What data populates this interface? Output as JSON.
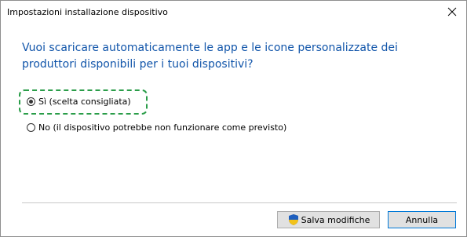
{
  "window": {
    "title": "Impostazioni installazione dispositivo"
  },
  "question": "Vuoi scaricare automaticamente le app e le icone personalizzate dei produttori disponibili per i tuoi dispositivi?",
  "options": [
    {
      "label": "Sì (scelta consigliata)",
      "selected": true
    },
    {
      "label": "No (il dispositivo potrebbe non funzionare come previsto)",
      "selected": false
    }
  ],
  "buttons": {
    "save_label": "Salva modifiche",
    "cancel_label": "Annulla"
  },
  "icons": {
    "save": "shield-icon",
    "close": "close-icon"
  },
  "colors": {
    "question_text": "#1155aa",
    "highlight": "#2a9d49",
    "default_button_border": "#0078d7"
  }
}
